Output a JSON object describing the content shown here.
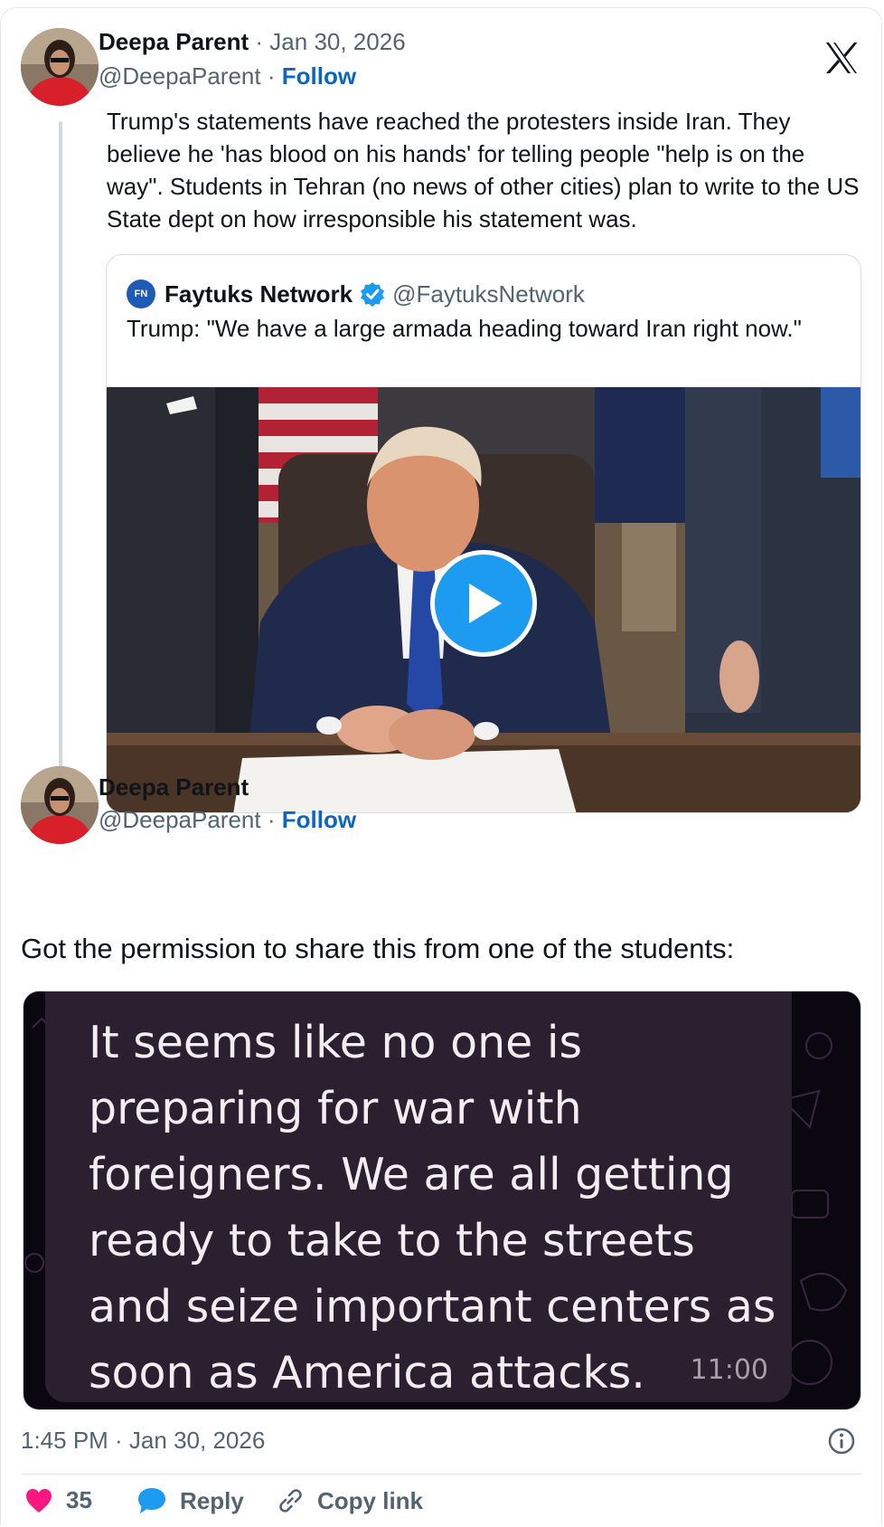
{
  "tweet1": {
    "name": "Deepa Parent",
    "date": "Jan 30, 2026",
    "handle": "@DeepaParent",
    "follow_label": "Follow",
    "text": "Trump's statements have reached the protesters inside Iran. They believe he 'has blood on his hands' for telling people \"help is on the way\". Students in Tehran (no news of other cities) plan to write to the US State dept on how irresponsible his statement was."
  },
  "quote": {
    "logo_text": "FN",
    "name": "Faytuks Network",
    "handle": "@FaytuksNetwork",
    "text": "Trump: \"We have a large armada heading toward Iran right now.\""
  },
  "tweet2": {
    "name": "Deepa Parent",
    "handle": "@DeepaParent",
    "follow_label": "Follow",
    "text": "Got the permission to share this from one of the students:",
    "image": {
      "message": "It seems like no one is preparing for war with foreigners. We are all getting ready to take to the streets and seize important centers as soon as America attacks.",
      "time": "11:00"
    },
    "timestamp": "1:45 PM · Jan 30, 2026",
    "likes": "35",
    "reply_label": "Reply",
    "copy_link_label": "Copy link"
  },
  "colors": {
    "accent": "#0c65c1",
    "play": "#1d9bf0",
    "like": "#f91880",
    "muted": "#536471"
  },
  "icons": [
    "x-logo-icon",
    "verified-badge-icon",
    "play-icon",
    "info-icon",
    "heart-icon",
    "reply-bubble-icon",
    "link-icon"
  ]
}
